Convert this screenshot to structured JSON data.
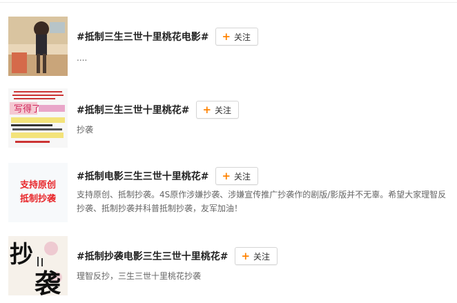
{
  "topics": [
    {
      "title": "#抵制三生三世十里桃花电影#",
      "follow_label": "关注",
      "description": "....",
      "thumbnail": "illustration-thumbnail"
    },
    {
      "title": "#抵制三生三世十里桃花#",
      "follow_label": "关注",
      "description": "抄袭",
      "thumbnail": "screenshot-thumbnail"
    },
    {
      "title": "#抵制电影三生三世十里桃花#",
      "follow_label": "关注",
      "description": "支持原创、抵制抄袭。4S原作涉嫌抄袭、涉嫌宣传推广抄袭作的剧版/影版并不无辜。希望大家理智反抄袭、抵制抄袭并科普抵制抄袭，友军加油！",
      "thumbnail": "text-thumbnail",
      "thumbnail_text": [
        "支持原创",
        "抵制抄袭"
      ]
    },
    {
      "title": "#抵制抄袭电影三生三世十里桃花#",
      "follow_label": "关注",
      "description": "理智反抄，三生三世十里桃花抄袭",
      "thumbnail": "calligraphy-thumbnail",
      "thumbnail_text": [
        "抄",
        "袭"
      ]
    }
  ],
  "colors": {
    "accent": "#ff8200",
    "thumb_text_red": "#e8262a"
  }
}
